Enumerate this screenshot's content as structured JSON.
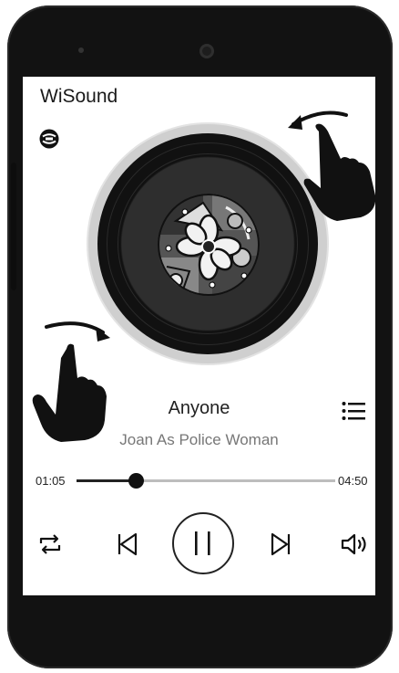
{
  "app": {
    "title": "WiSound"
  },
  "track": {
    "title": "Anyone",
    "artist": "Joan As Police Woman"
  },
  "progress": {
    "current": "01:05",
    "total": "04:50",
    "fraction": 0.23
  },
  "controls": {
    "icons": [
      "repeat-icon",
      "previous-icon",
      "pause-icon",
      "next-icon",
      "volume-icon"
    ]
  },
  "colors": {
    "screen": "#ffffff",
    "phone": "#121212",
    "accent": "#111111"
  }
}
